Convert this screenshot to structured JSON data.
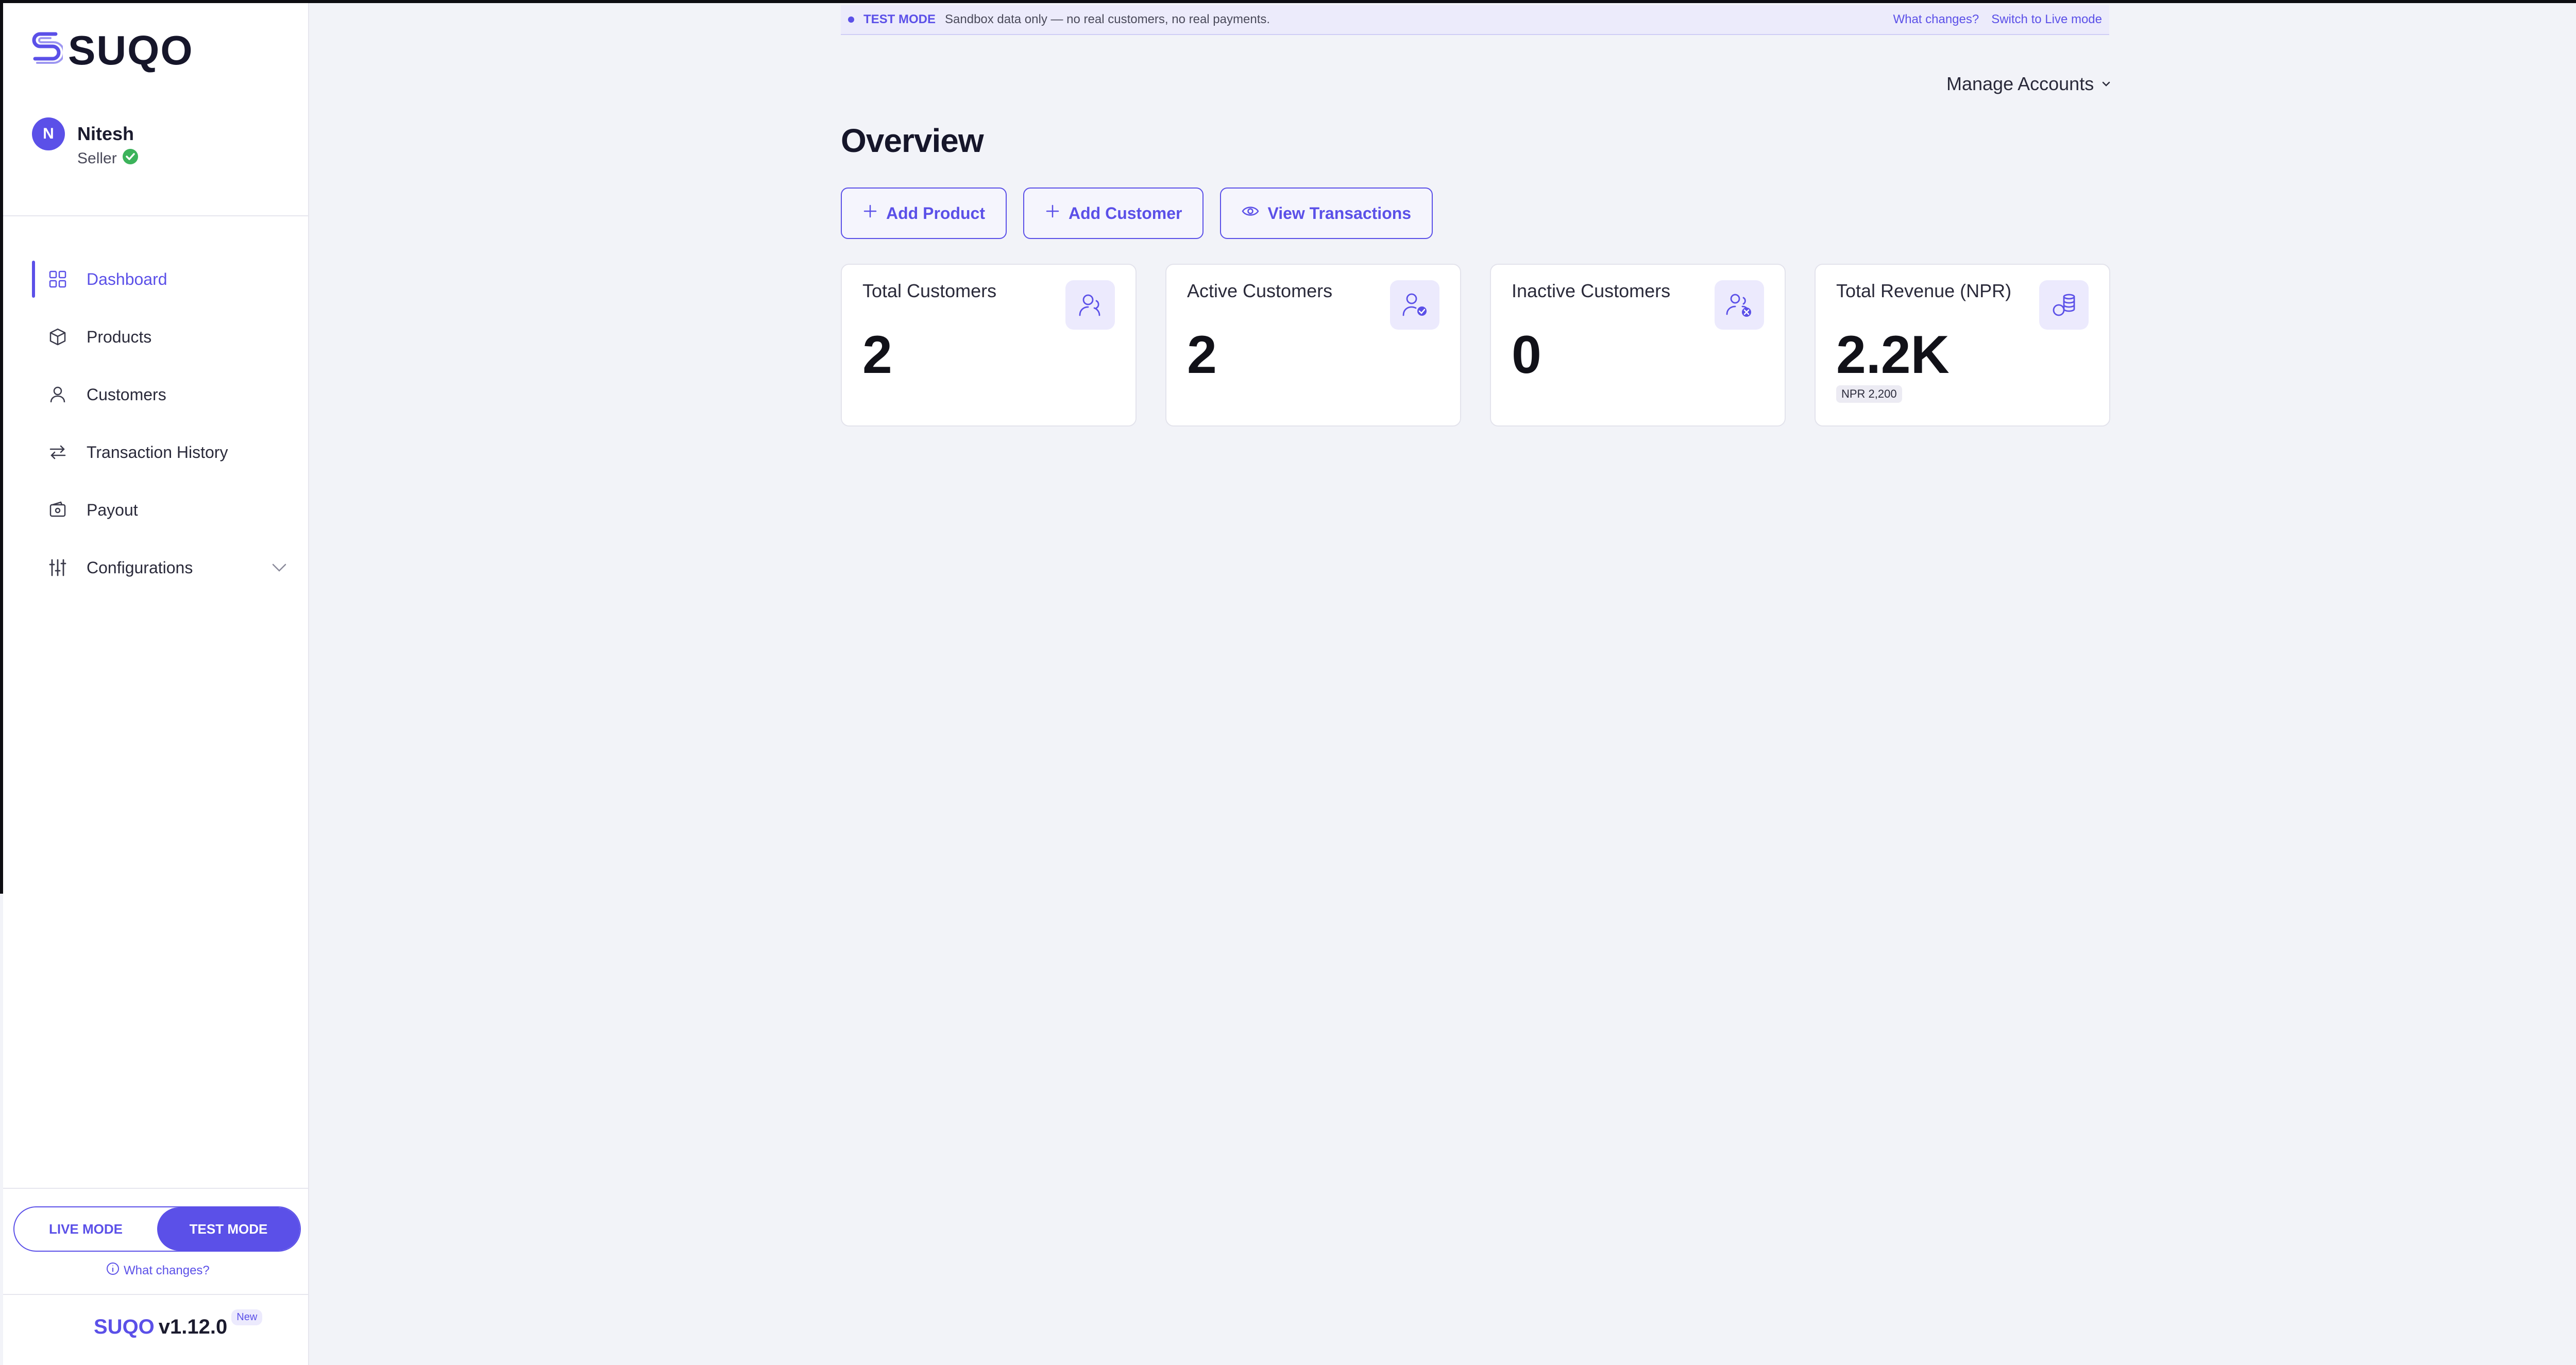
{
  "brand": {
    "name": "SUQO",
    "accent": "#5b50e8"
  },
  "user": {
    "initial": "N",
    "name": "Nitesh",
    "role": "Seller"
  },
  "nav": [
    {
      "label": "Dashboard",
      "icon": "grid-icon",
      "active": true
    },
    {
      "label": "Products",
      "icon": "box-icon"
    },
    {
      "label": "Customers",
      "icon": "user-icon"
    },
    {
      "label": "Transaction History",
      "icon": "arrows-icon"
    },
    {
      "label": "Payout",
      "icon": "wallet-icon"
    },
    {
      "label": "Configurations",
      "icon": "sliders-icon",
      "expandable": true
    }
  ],
  "mode": {
    "live_label": "LIVE MODE",
    "test_label": "TEST MODE",
    "selected": "TEST MODE",
    "what_changes": "What changes?"
  },
  "version": {
    "brand": "SUQO",
    "number": "v1.12.0",
    "badge": "New"
  },
  "banner": {
    "tag": "TEST MODE",
    "message": "Sandbox data only — no real customers, no real payments.",
    "link_changes": "What changes?",
    "link_switch": "Switch to Live mode"
  },
  "header": {
    "manage_accounts": "Manage Accounts",
    "title": "Overview"
  },
  "actions": [
    "Add Product",
    "Add Customer",
    "View Transactions"
  ],
  "stats": [
    {
      "title": "Total Customers",
      "value": "2",
      "icon": "users-icon"
    },
    {
      "title": "Active Customers",
      "value": "2",
      "icon": "user-check-icon"
    },
    {
      "title": "Inactive Customers",
      "value": "0",
      "icon": "user-x-icon"
    },
    {
      "title": "Total Revenue (NPR)",
      "value": "2.2K",
      "sub": "NPR 2,200",
      "icon": "coins-icon"
    }
  ]
}
